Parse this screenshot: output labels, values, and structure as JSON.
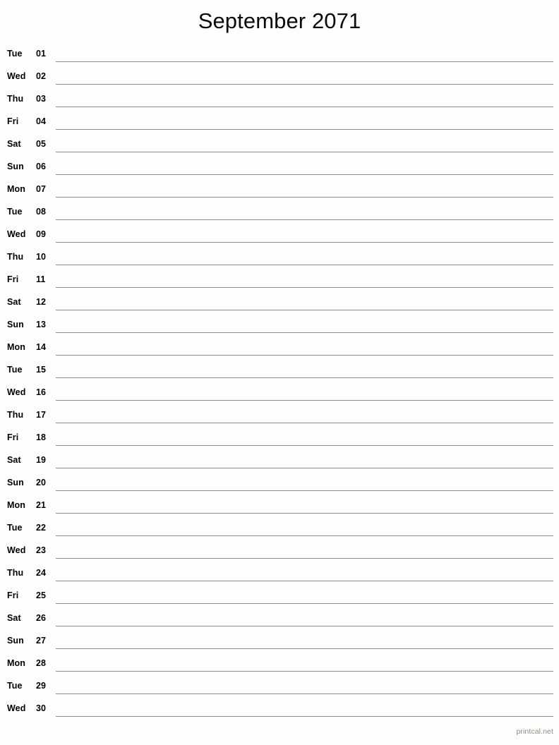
{
  "header": {
    "title": "September 2071",
    "month_name": "September",
    "year": "2071"
  },
  "calendar": {
    "layout": "single-column-notepad",
    "columns": [
      "weekday",
      "day_number",
      "notes_line"
    ],
    "days": [
      {
        "weekday": "Tue",
        "day": "01"
      },
      {
        "weekday": "Wed",
        "day": "02"
      },
      {
        "weekday": "Thu",
        "day": "03"
      },
      {
        "weekday": "Fri",
        "day": "04"
      },
      {
        "weekday": "Sat",
        "day": "05"
      },
      {
        "weekday": "Sun",
        "day": "06"
      },
      {
        "weekday": "Mon",
        "day": "07"
      },
      {
        "weekday": "Tue",
        "day": "08"
      },
      {
        "weekday": "Wed",
        "day": "09"
      },
      {
        "weekday": "Thu",
        "day": "10"
      },
      {
        "weekday": "Fri",
        "day": "11"
      },
      {
        "weekday": "Sat",
        "day": "12"
      },
      {
        "weekday": "Sun",
        "day": "13"
      },
      {
        "weekday": "Mon",
        "day": "14"
      },
      {
        "weekday": "Tue",
        "day": "15"
      },
      {
        "weekday": "Wed",
        "day": "16"
      },
      {
        "weekday": "Thu",
        "day": "17"
      },
      {
        "weekday": "Fri",
        "day": "18"
      },
      {
        "weekday": "Sat",
        "day": "19"
      },
      {
        "weekday": "Sun",
        "day": "20"
      },
      {
        "weekday": "Mon",
        "day": "21"
      },
      {
        "weekday": "Tue",
        "day": "22"
      },
      {
        "weekday": "Wed",
        "day": "23"
      },
      {
        "weekday": "Thu",
        "day": "24"
      },
      {
        "weekday": "Fri",
        "day": "25"
      },
      {
        "weekday": "Sat",
        "day": "26"
      },
      {
        "weekday": "Sun",
        "day": "27"
      },
      {
        "weekday": "Mon",
        "day": "28"
      },
      {
        "weekday": "Tue",
        "day": "29"
      },
      {
        "weekday": "Wed",
        "day": "30"
      }
    ]
  },
  "footer": {
    "attribution": "printcal.net"
  },
  "colors": {
    "page_background": "#fdfdfb",
    "text": "#000000",
    "rule_line": "#8a8a87",
    "footer_text": "#8d8d8a"
  }
}
